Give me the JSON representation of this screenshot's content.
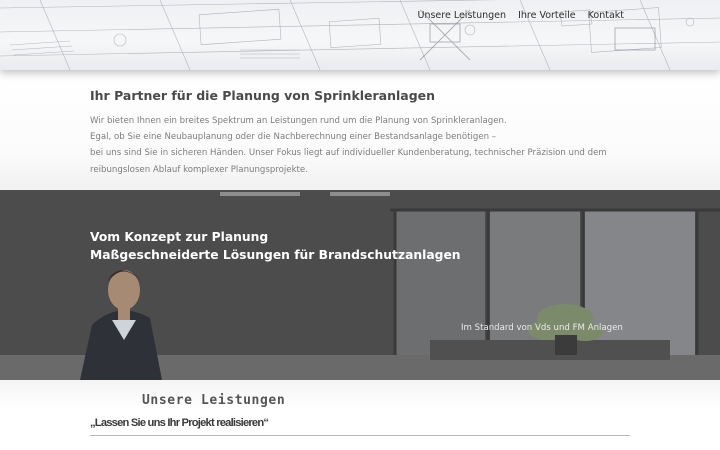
{
  "nav": {
    "items": [
      "Unsere Leistungen",
      "Ihre Vorteile",
      "Kontakt"
    ]
  },
  "intro": {
    "title": "Ihr Partner für die Planung von Sprinkleranlagen",
    "lines": [
      "Wir bieten Ihnen ein breites Spektrum an Leistungen rund um die Planung von Sprinkleranlagen.",
      "Egal, ob Sie eine Neubauplanung oder die Nachberechnung einer Bestandsanlage benötigen –",
      "bei uns sind Sie in sicheren Händen. Unser Fokus liegt auf individueller Kundenberatung, technischer Präzision und dem",
      "reibungslosen Ablauf komplexer Planungsprojekte."
    ]
  },
  "hero": {
    "line1": "Vom Konzept zur Planung",
    "line2": "Maßgeschneiderte Lösungen für Brandschutzanlagen",
    "standard": "Im Standard von Vds und FM Anlagen"
  },
  "services": {
    "heading": "Unsere Leistungen",
    "quote": "„Lassen Sie uns Ihr Projekt realisieren“"
  },
  "colors": {
    "text_dark": "#4a4a4a",
    "text_muted": "#7d7d7d",
    "hero_bg": "#5b5b5c",
    "white": "#ffffff"
  }
}
